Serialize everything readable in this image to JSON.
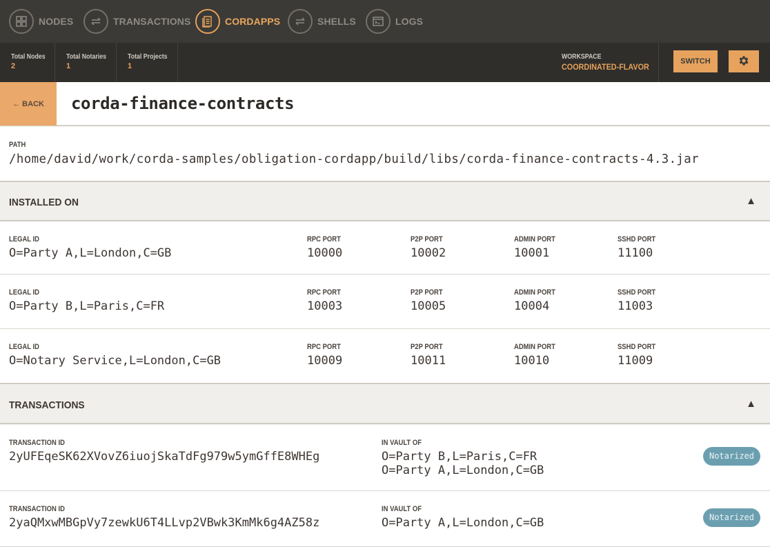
{
  "nav": {
    "items": [
      {
        "label": "NODES",
        "icon": "grid-icon",
        "active": false
      },
      {
        "label": "TRANSACTIONS",
        "icon": "arrows-icon",
        "active": false
      },
      {
        "label": "CORDAPPS",
        "icon": "document-icon",
        "active": true
      },
      {
        "label": "SHELLS",
        "icon": "arrows-icon",
        "active": false
      },
      {
        "label": "LOGS",
        "icon": "terminal-icon",
        "active": false
      }
    ],
    "accent_color": "#e6a15a"
  },
  "stats": {
    "total_nodes_label": "Total Nodes",
    "total_nodes": "2",
    "total_notaries_label": "Total Notaries",
    "total_notaries": "1",
    "total_projects_label": "Total Projects",
    "total_projects": "1",
    "workspace_label": "WORKSPACE",
    "workspace_name": "COORDINATED-FLAVOR",
    "switch_label": "SWITCH",
    "settings_icon": "gear-icon"
  },
  "header": {
    "back_label": "← BACK",
    "title": "corda-finance-contracts"
  },
  "path": {
    "label": "PATH",
    "value": "/home/david/work/corda-samples/obligation-cordapp/build/libs/corda-finance-contracts-4.3.jar"
  },
  "installed": {
    "title": "INSTALLED ON",
    "caret": "▲",
    "labels": {
      "legal_id": "LEGAL ID",
      "rpc": "RPC PORT",
      "p2p": "P2P PORT",
      "admin": "ADMIN PORT",
      "sshd": "SSHD PORT"
    },
    "nodes": [
      {
        "legal_id": "O=Party A,L=London,C=GB",
        "rpc": "10000",
        "p2p": "10002",
        "admin": "10001",
        "sshd": "11100"
      },
      {
        "legal_id": "O=Party B,L=Paris,C=FR",
        "rpc": "10003",
        "p2p": "10005",
        "admin": "10004",
        "sshd": "11003"
      },
      {
        "legal_id": "O=Notary Service,L=London,C=GB",
        "rpc": "10009",
        "p2p": "10011",
        "admin": "10010",
        "sshd": "11009"
      }
    ]
  },
  "transactions": {
    "title": "TRANSACTIONS",
    "caret": "▲",
    "labels": {
      "tx_id": "TRANSACTION ID",
      "vault": "IN VAULT OF"
    },
    "items": [
      {
        "id": "2yUFEqeSK62XVovZ6iuojSkaTdFg979w5ymGffE8WHEg",
        "vault": [
          "O=Party B,L=Paris,C=FR",
          "O=Party A,L=London,C=GB"
        ],
        "status": "Notarized"
      },
      {
        "id": "2yaQMxwMBGpVy7zewkU6T4LLvp2VBwk3KmMk6g4AZ58z",
        "vault": [
          "O=Party A,L=London,C=GB"
        ],
        "status": "Notarized"
      }
    ],
    "badge_color": "#6b9fb0"
  }
}
